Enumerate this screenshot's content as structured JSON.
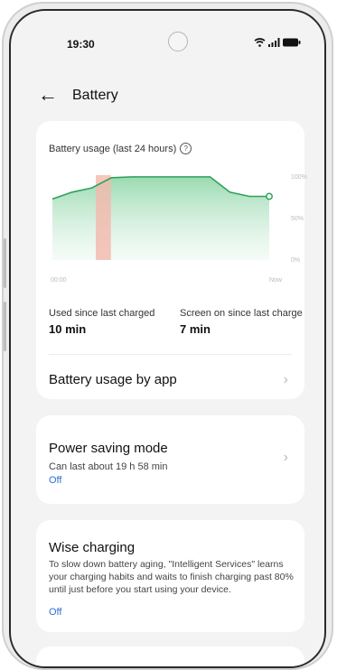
{
  "status_bar": {
    "time": "19:30"
  },
  "header": {
    "title": "Battery"
  },
  "usage_card": {
    "title": "Battery usage (last 24 hours)",
    "help_symbol": "?",
    "y_ticks": [
      "100%",
      "50%",
      "0%"
    ],
    "x_ticks": [
      "00:00",
      "Now"
    ],
    "used_since_label": "Used since last charged",
    "used_since_value": "10 min",
    "screen_on_label": "Screen on since last charge",
    "screen_on_value": "7 min",
    "usage_by_app_label": "Battery usage by app"
  },
  "power_saving": {
    "title": "Power saving mode",
    "subtitle": "Can last about 19 h 58 min",
    "state": "Off"
  },
  "wise_charging": {
    "title": "Wise charging",
    "description": "To slow down battery aging, \"Intelligent Services\" learns your charging habits and waits to finish charging past 80% until just before you start using your device.",
    "state": "Off"
  },
  "chart_data": {
    "type": "area",
    "x": [
      "00:00",
      "Now"
    ],
    "y_ticks": [
      "0%",
      "50%",
      "100%"
    ],
    "ylim": [
      0,
      100
    ],
    "level": [
      72,
      80,
      85,
      97,
      98,
      98,
      98,
      98,
      98,
      80,
      75,
      75
    ],
    "charging_segment_fraction": [
      0.2,
      0.27
    ],
    "line_color": "#2ea15a",
    "fill_color": "#cfeedd",
    "charging_color": "#f4b8ad"
  }
}
